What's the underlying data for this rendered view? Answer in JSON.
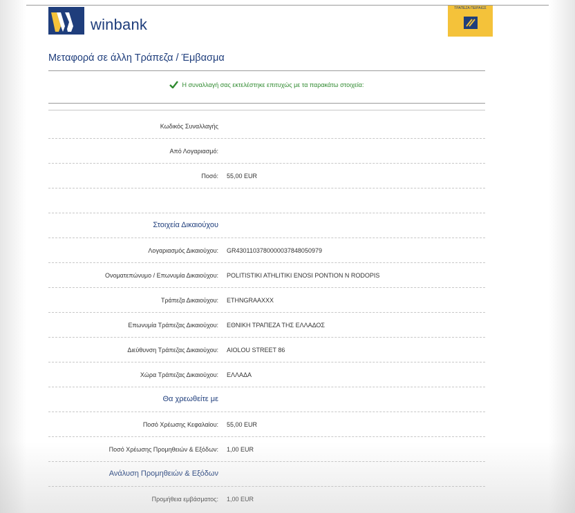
{
  "header": {
    "brand_name": "winbank",
    "bank_logo_caption": "ΤΡΑΠΕΖΑ ΠΕΙΡΑΙΩΣ",
    "colors": {
      "brand_blue": "#1f3e7c",
      "bank_yellow": "#f4c23a",
      "success_green": "#2f8a2f"
    }
  },
  "page_title": "Μεταφορά σε άλλη Τράπεζα / Έμβασμα",
  "success_message": "Η συναλλαγή σας εκτελέστηκε επιτυχώς με τα παρακάτω στοιχεία:",
  "transaction": {
    "code_label": "Κωδικός Συναλλαγής",
    "code_value": "",
    "from_account_label": "Από Λογαριασμό:",
    "from_account_value": "",
    "amount_label": "Ποσό:",
    "amount_value": "55,00 EUR"
  },
  "beneficiary": {
    "section_title": "Στοιχεία Δικαιούχου",
    "account_label": "Λογαριασμός Δικαιούχου:",
    "account_value": "GR4301103780000037848050979",
    "name_label": "Ονοματεπώνυμο / Επωνυμία Δικαιούχου:",
    "name_value": "POLITISTIKI ATHLITIKI ENOSI PONTION N RODOPIS",
    "bank_label": "Τράπεζα Δικαιούχου:",
    "bank_value": "ETHNGRAAXXX",
    "bank_name_label": "Επωνυμία Τράπεζας Δικαιούχου:",
    "bank_name_value": "ΕΘΝΙΚΗ ΤΡΑΠΕΖΑ ΤΗΣ ΕΛΛΑΔΟΣ",
    "bank_address_label": "Διεύθυνση Τράπεζας Δικαιούχου:",
    "bank_address_value": "AIOLOU STREET 86",
    "bank_country_label": "Χώρα Τράπεζας Δικαιούχου:",
    "bank_country_value": "ΕΛΛΑΔΑ"
  },
  "charges": {
    "section_title": "Θα χρεωθείτε με",
    "principal_label": "Ποσό Χρέωσης Κεφαλαίου:",
    "principal_value": "55,00 EUR",
    "fees_label": "Ποσό Χρέωσης Προμηθειών & Εξόδων:",
    "fees_value": "1,00 EUR"
  },
  "fees_breakdown": {
    "section_title": "Ανάλυση Προμηθειών & Εξόδων",
    "remittance_fee_label": "Προμήθεια εμβάσματος:",
    "remittance_fee_value": "1,00 EUR"
  }
}
